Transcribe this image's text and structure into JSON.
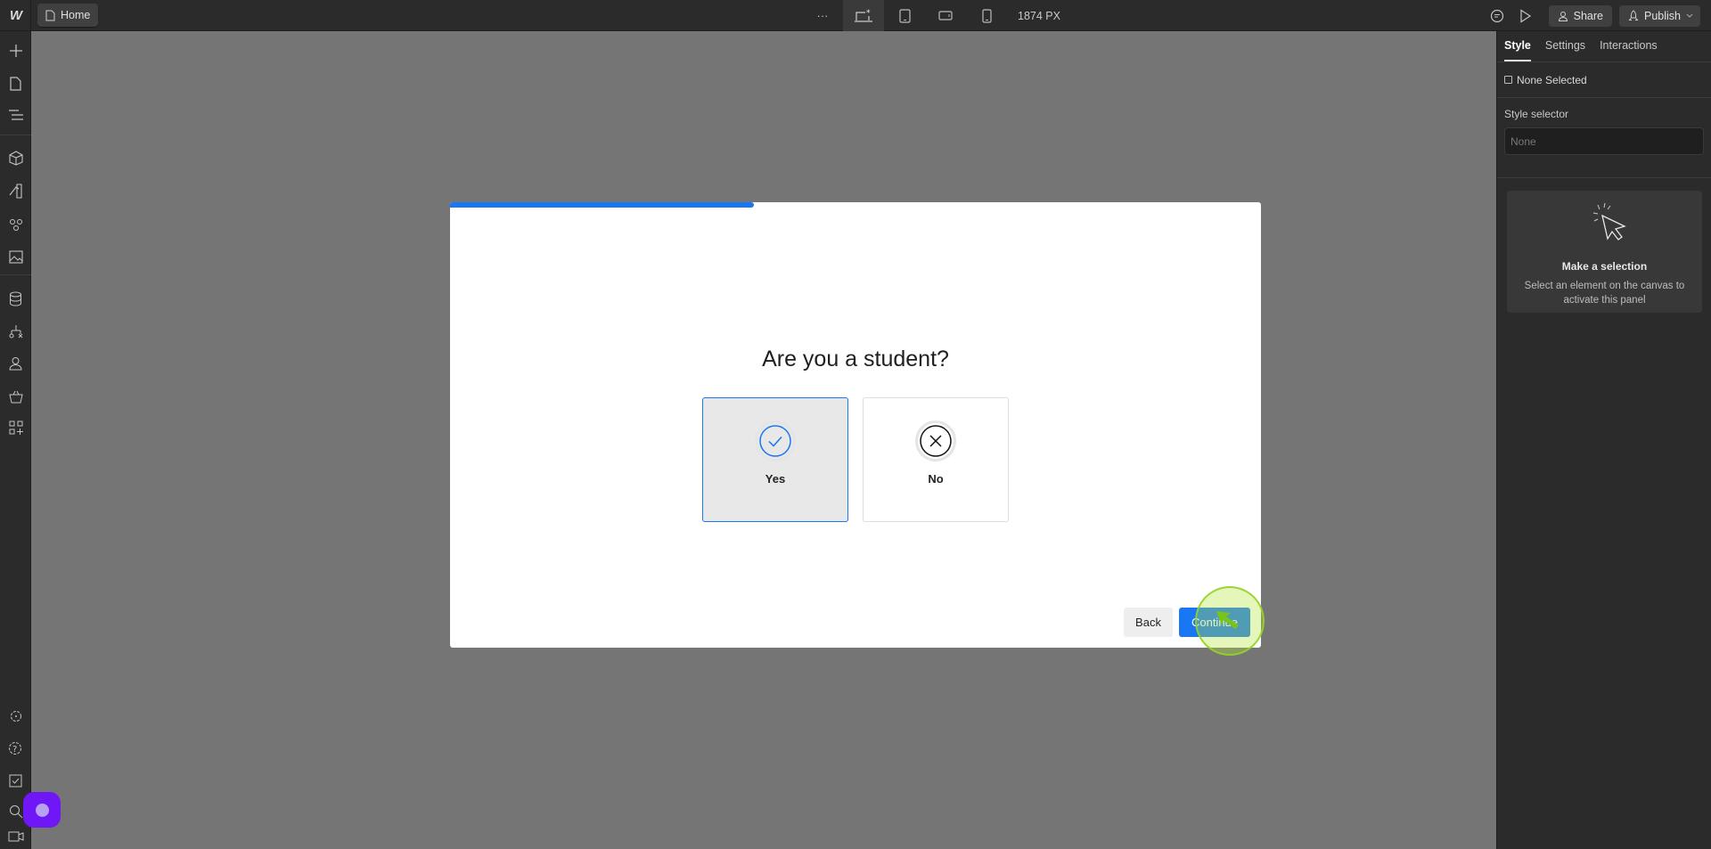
{
  "topbar": {
    "logo": "W",
    "page_name": "Home",
    "more_label": "···",
    "breakpoints": [
      "desktop-base",
      "tablet",
      "mobile-landscape",
      "mobile-portrait"
    ],
    "active_breakpoint": "desktop-base",
    "width_readout": "1874 PX",
    "share_label": "Share",
    "publish_label": "Publish"
  },
  "leftbar": {
    "items": [
      "add",
      "pages",
      "navigator",
      "components",
      "style-manager",
      "variables",
      "assets",
      "cms",
      "logic",
      "users",
      "ecommerce",
      "apps"
    ],
    "bottom_items": [
      "settings",
      "help",
      "audit",
      "search",
      "video-tutorials"
    ]
  },
  "modal": {
    "progress_percent": 37.5,
    "question": "Are you a student?",
    "options": [
      {
        "label": "Yes",
        "icon": "check-circle-icon",
        "selected": true
      },
      {
        "label": "No",
        "icon": "x-circle-icon",
        "selected": false
      }
    ],
    "back_label": "Back",
    "continue_label": "Continue"
  },
  "rightpanel": {
    "tabs": [
      "Style",
      "Settings",
      "Interactions"
    ],
    "active_tab": "Style",
    "none_selected": "None Selected",
    "style_selector_label": "Style selector",
    "style_selector_placeholder": "None",
    "empty_title": "Make a selection",
    "empty_desc": "Select an element on the canvas to activate this panel"
  },
  "colors": {
    "accent": "#1976f5",
    "fab": "#6f17f5",
    "canvas": "#757575"
  }
}
